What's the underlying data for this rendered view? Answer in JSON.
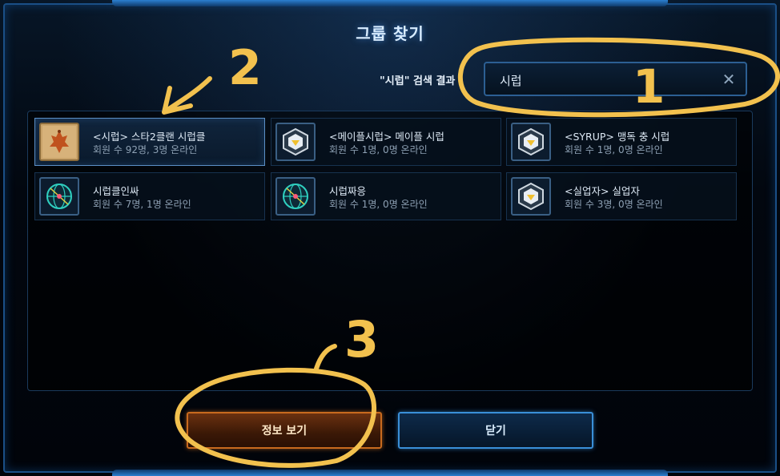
{
  "dialog": {
    "title": "그룹 찾기",
    "result_label": "\"시럽\" 검색 결과"
  },
  "search": {
    "value": "시럽",
    "clear_glyph": "✕"
  },
  "results": [
    {
      "name": "<시럽> 스타2클랜 시럽클",
      "meta": "회원 수 92명, 3명 온라인",
      "icon": "clan-emblem-icon",
      "selected": true
    },
    {
      "name": "<메이플시럽> 메이플 시럽",
      "meta": "회원 수 1명, 0명 온라인",
      "icon": "clan-badge-icon",
      "selected": false
    },
    {
      "name": "<SYRUP> 맹독 충 시럽",
      "meta": "회원 수 1명, 0명 온라인",
      "icon": "clan-badge-icon",
      "selected": false
    },
    {
      "name": "시럽클인싸",
      "meta": "회원 수 7명, 1명 온라인",
      "icon": "group-globe-icon",
      "selected": false
    },
    {
      "name": "시럽짜응",
      "meta": "회원 수 1명, 0명 온라인",
      "icon": "group-globe-icon",
      "selected": false
    },
    {
      "name": "<실업자> 실업자",
      "meta": "회원 수 3명, 0명 온라인",
      "icon": "clan-badge-icon",
      "selected": false
    }
  ],
  "buttons": {
    "info": "정보 보기",
    "close": "닫기"
  },
  "annotations": {
    "color": "#f2c14e",
    "labels": [
      "1",
      "2",
      "3"
    ]
  }
}
